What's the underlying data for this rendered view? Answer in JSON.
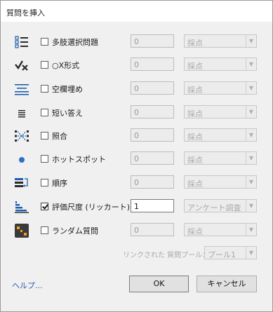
{
  "window": {
    "title": "質問を挿入"
  },
  "rows": [
    {
      "icon": "multiple-choice-icon",
      "label": "多肢選択問題",
      "checked": false,
      "count": "0",
      "scoring": "採点",
      "enabled": false
    },
    {
      "icon": "true-false-icon",
      "label": "○X形式",
      "checked": false,
      "count": "0",
      "scoring": "採点",
      "enabled": false
    },
    {
      "icon": "fill-blank-icon",
      "label": "空欄埋め",
      "checked": false,
      "count": "0",
      "scoring": "採点",
      "enabled": false
    },
    {
      "icon": "short-answer-icon",
      "label": "短い答え",
      "checked": false,
      "count": "0",
      "scoring": "採点",
      "enabled": false
    },
    {
      "icon": "matching-icon",
      "label": "照合",
      "checked": false,
      "count": "0",
      "scoring": "採点",
      "enabled": false
    },
    {
      "icon": "hotspot-icon",
      "label": "ホットスポット",
      "checked": false,
      "count": "0",
      "scoring": "採点",
      "enabled": false
    },
    {
      "icon": "sequence-icon",
      "label": "順序",
      "checked": false,
      "count": "0",
      "scoring": "採点",
      "enabled": false
    },
    {
      "icon": "likert-icon",
      "label": "評価尺度 (リッカート)",
      "checked": true,
      "count": "1",
      "scoring": "アンケート調査",
      "enabled": true
    },
    {
      "icon": "random-question-icon",
      "label": "ランダム質問",
      "checked": false,
      "count": "0",
      "scoring": "採点",
      "enabled": false
    }
  ],
  "linked_pool": {
    "label": "リンクされた 質問プール：",
    "value": "プール1"
  },
  "footer": {
    "help": "ヘルプ...",
    "ok": "OK",
    "cancel": "キャンセル"
  },
  "colors": {
    "accent_blue": "#2b6fc4",
    "orange": "#f0a020",
    "link": "#2a5db0"
  }
}
